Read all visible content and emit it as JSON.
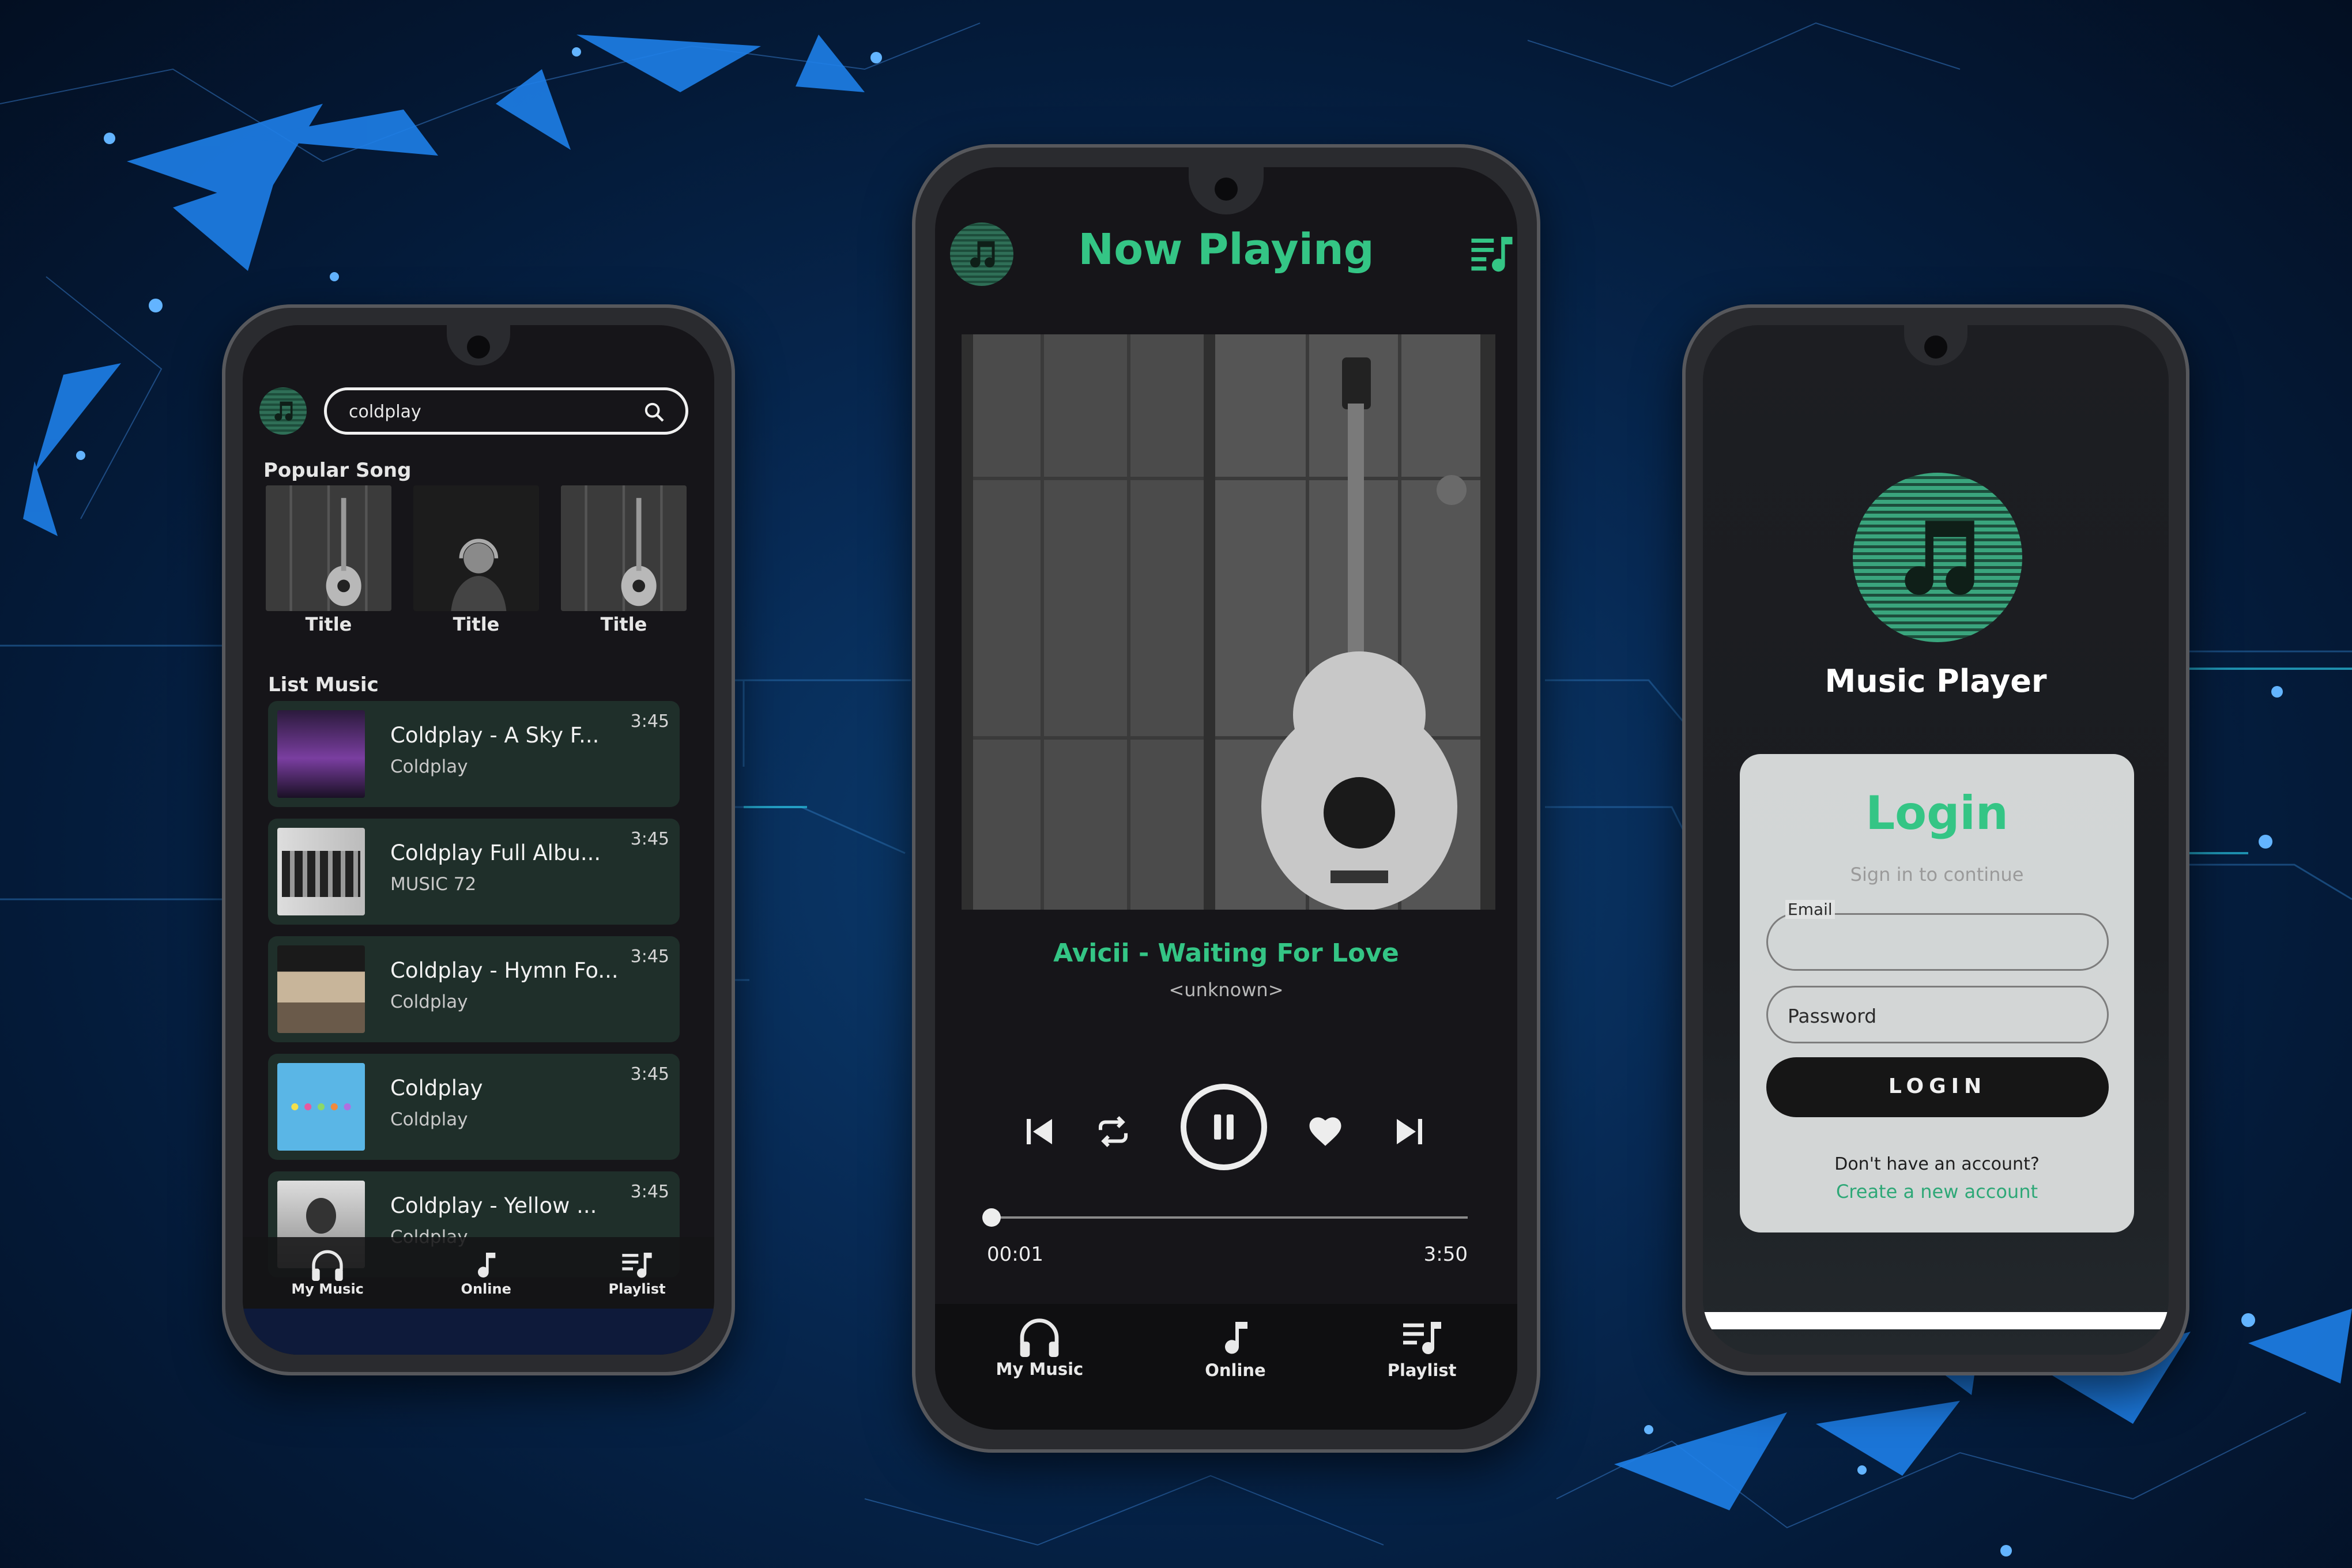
{
  "colors": {
    "accent": "#34c585",
    "screen_bg": "#161519",
    "card_bg": "#1f2f2a",
    "phone_frame": "#2a2b2f",
    "background": "#072a55"
  },
  "left_phone": {
    "logo_icon": "music-note-icon",
    "search": {
      "value": "coldplay",
      "icon": "search-icon"
    },
    "popular_heading": "Popular Song",
    "popular": [
      {
        "title": "Title"
      },
      {
        "title": "Title"
      },
      {
        "title": "Title"
      }
    ],
    "list_heading": "List Music",
    "list": [
      {
        "title": "Coldplay - A Sky F...",
        "subtitle": "Coldplay",
        "duration": "3:45"
      },
      {
        "title": "Coldplay Full Albu...",
        "subtitle": "MUSIC 72",
        "duration": "3:45"
      },
      {
        "title": "Coldplay - Hymn Fo...",
        "subtitle": "Coldplay",
        "duration": "3:45"
      },
      {
        "title": "Coldplay",
        "subtitle": "Coldplay",
        "duration": "3:45"
      },
      {
        "title": "Coldplay - Yellow ...",
        "subtitle": "Coldplay",
        "duration": "3:45"
      }
    ],
    "nav": [
      {
        "label": "My Music",
        "icon": "headphones-icon"
      },
      {
        "label": "Online",
        "icon": "music-note-icon"
      },
      {
        "label": "Playlist",
        "icon": "playlist-icon"
      }
    ]
  },
  "center_phone": {
    "title": "Now Playing",
    "logo_icon": "music-note-icon",
    "playlist_icon": "playlist-icon",
    "song_title": "Avicii - Waiting For Love",
    "artist": "<unknown>",
    "controls": [
      "previous-icon",
      "repeat-icon",
      "pause-icon",
      "heart-icon",
      "next-icon"
    ],
    "progress": {
      "current": "00:01",
      "total": "3:50",
      "fraction": 0.005
    },
    "nav": [
      {
        "label": "My Music",
        "icon": "headphones-icon"
      },
      {
        "label": "Online",
        "icon": "music-note-icon"
      },
      {
        "label": "Playlist",
        "icon": "playlist-icon"
      }
    ]
  },
  "right_phone": {
    "app_name": "Music Player",
    "login_title": "Login",
    "login_subtitle": "Sign in to continue",
    "email_label": "Email",
    "email_value": "",
    "password_placeholder": "Password",
    "login_button": "LOGIN",
    "no_account": "Don't have an account?",
    "create_account": "Create a new account"
  }
}
